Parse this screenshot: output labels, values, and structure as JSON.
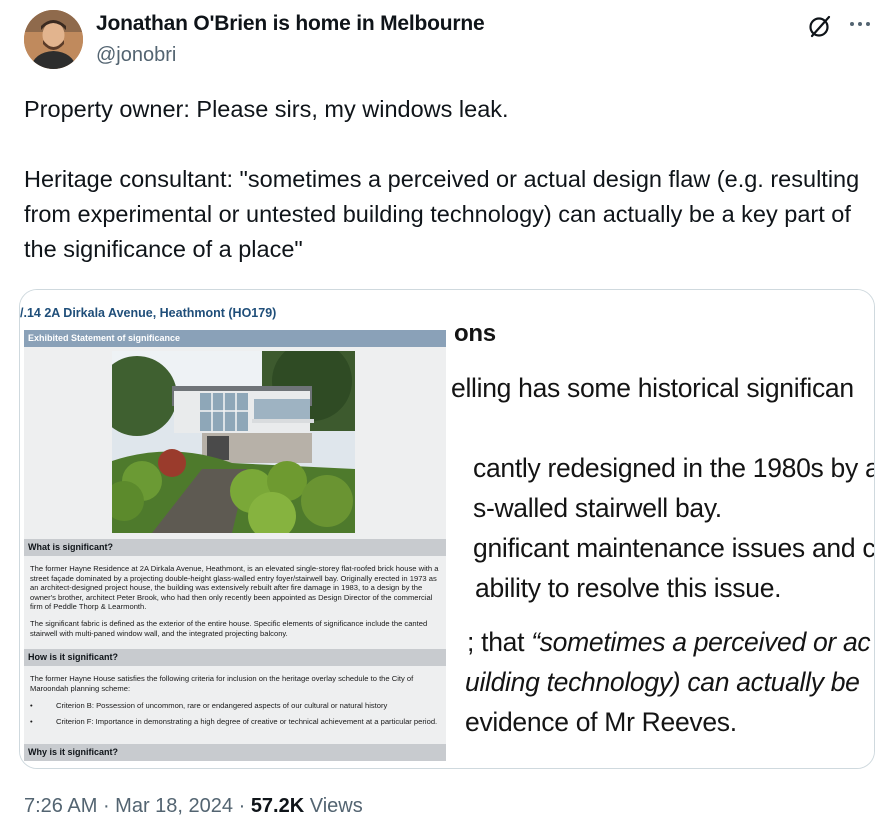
{
  "author": {
    "name": "Jonathan O'Brien is home in Melbourne",
    "handle": "@jonobri"
  },
  "icons": {
    "grok": "grok-icon",
    "more": "more-icon"
  },
  "tweet": {
    "line1": "Property owner: Please sirs, my windows leak.",
    "line2": "Heritage consultant: \"sometimes a perceived or actual design flaw (e.g. resulting from experimental or untested building technology) can actually be a key part of the significance of a place\""
  },
  "doc": {
    "title": "/.14   2A Dirkala Avenue, Heathmont (HO179)",
    "statement_bar": "Exhibited Statement of significance",
    "what_heading": "What is significant?",
    "what_p1": "The former Hayne Residence at 2A Dirkala Avenue, Heathmont, is an elevated single-storey flat-roofed brick house with a street façade dominated by a projecting double-height glass-walled entry foyer/stairwell bay.  Originally erected in 1973 as an architect-designed project house, the building was extensively rebuilt after fire damage in 1983, to a design by the owner's brother, architect Peter Brook, who had then only recently been appointed as Design Director of the commercial firm of Peddle Thorp & Learmonth.",
    "what_p2": "The significant fabric is defined as the exterior of the entire house. Specific elements of significance include the canted stairwell with multi-paned window wall, and the integrated projecting balcony.",
    "how_heading": "How is it significant?",
    "how_p1": "The former Hayne House satisfies the following criteria for inclusion on the heritage overlay schedule to the City of Maroondah planning scheme:",
    "bullet_char": "•",
    "criterion_b": "Criterion B: Possession of uncommon, rare or endangered aspects of our cultural or natural history",
    "criterion_f": "Criterion F: Importance in demonstrating a high degree of creative or technical achievement at a particular period.",
    "why_heading": "Why is it significant?"
  },
  "slide": {
    "l1": "ons",
    "l2": "elling has some historical significan",
    "l3": "cantly redesigned in the 1980s by a",
    "l4": "s-walled stairwell bay.",
    "l5": "gnificant maintenance issues and c",
    "l6": "ability to resolve this issue.",
    "l7_plain": "; that ",
    "l7_italic": "“sometimes a perceived or ac",
    "l8": "uilding technology) can actually be",
    "l9": "evidence of Mr Reeves."
  },
  "footer": {
    "time": "7:26 AM",
    "sep1": " · ",
    "date": "Mar 18, 2024",
    "sep2": " · ",
    "views_count": "57.2K",
    "views_label": " Views"
  }
}
